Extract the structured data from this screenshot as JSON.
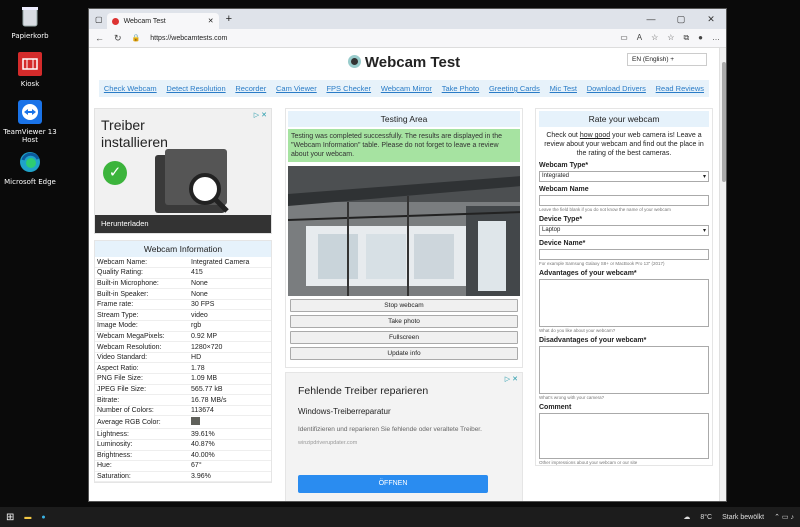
{
  "desktop": {
    "icons": [
      {
        "label": "Papierkorb"
      },
      {
        "label": "Kiosk"
      },
      {
        "label": "TeamViewer 13 Host"
      },
      {
        "label": "Microsoft Edge"
      }
    ]
  },
  "browser": {
    "tab_title": "Webcam Test",
    "url": "https://webcamtests.com"
  },
  "page": {
    "title": "Webcam Test",
    "language": "EN (English) +",
    "nav": [
      "Check Webcam",
      "Detect Resolution",
      "Recorder",
      "Cam Viewer",
      "FPS Checker",
      "Webcam Mirror",
      "Take Photo",
      "Greeting Cards",
      "Mic Test",
      "Download Drivers",
      "Read Reviews"
    ],
    "ad1": {
      "line1": "Treiber",
      "line2": "installieren",
      "cta": "Herunterladen"
    },
    "info": {
      "title": "Webcam Information",
      "rows": [
        [
          "Webcam Name:",
          "Integrated Camera"
        ],
        [
          "Quality Rating:",
          "415"
        ],
        [
          "Built-in Microphone:",
          "None"
        ],
        [
          "Built-in Speaker:",
          "None"
        ],
        [
          "Frame rate:",
          "30 FPS"
        ],
        [
          "Stream Type:",
          "video"
        ],
        [
          "Image Mode:",
          "rgb"
        ],
        [
          "Webcam MegaPixels:",
          "0.92 MP"
        ],
        [
          "Webcam Resolution:",
          "1280×720"
        ],
        [
          "Video Standard:",
          "HD"
        ],
        [
          "Aspect Ratio:",
          "1.78"
        ],
        [
          "PNG File Size:",
          "1.09 MB"
        ],
        [
          "JPEG File Size:",
          "565.77 kB"
        ],
        [
          "Bitrate:",
          "16.78 MB/s"
        ],
        [
          "Number of Colors:",
          "113674"
        ],
        [
          "Average RGB Color:",
          ""
        ],
        [
          "Lightness:",
          "39.61%"
        ],
        [
          "Luminosity:",
          "40.87%"
        ],
        [
          "Brightness:",
          "40.00%"
        ],
        [
          "Hue:",
          "67°"
        ],
        [
          "Saturation:",
          "3.96%"
        ]
      ]
    },
    "testing": {
      "title": "Testing Area",
      "message": "Testing was completed successfully. The results are displayed in the \"Webcam Information\" table. Please do not forget to leave a review about your webcam.",
      "buttons": [
        "Stop webcam",
        "Take photo",
        "Fullscreen",
        "Update info"
      ]
    },
    "ad2": {
      "title": "Fehlende Treiber reparieren",
      "subtitle": "Windows-Treiberreparatur",
      "body": "Identifizieren und reparieren Sie fehlende oder veraltete Treiber.",
      "domain": "winzipdriverupdater.com",
      "cta": "ÖFFNEN"
    },
    "rate": {
      "title": "Rate your webcam",
      "intro_a": "Check out ",
      "intro_link": "how good",
      "intro_b": " your web camera is! Leave a review about your webcam and find out the place in the rating of the best cameras.",
      "type_label": "Webcam Type*",
      "type_value": "Integrated",
      "name_label": "Webcam Name",
      "name_hint": "Leave the field blank if you do not know the name of your webcam",
      "device_label": "Device Type*",
      "device_value": "Laptop",
      "devname_label": "Device Name*",
      "devname_hint": "For example Samsung Galaxy S8+ or MacBook Pro 13\" (2017)",
      "adv_label": "Advantages of your webcam*",
      "adv_hint": "What do you like about your webcam?",
      "dis_label": "Disadvantages of your webcam*",
      "dis_hint": "What's wrong with your camera?",
      "comment_label": "Comment",
      "comment_hint": "Other impressions about your webcam or our site"
    }
  },
  "taskbar": {
    "temp": "8°C",
    "weather": "Stark bewölkt"
  },
  "colors": {
    "avg_rgb": "#5f605a",
    "success_bg": "#a6e3a1",
    "ad_blue": "#2a8cf0"
  }
}
